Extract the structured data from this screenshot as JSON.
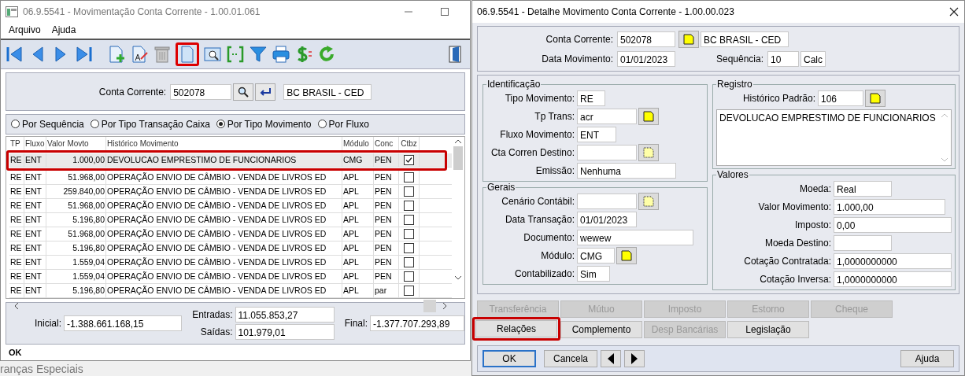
{
  "background": [
    {
      "text": "ranças Especiais"
    }
  ],
  "left_window": {
    "title": "06.9.5541 - Movimentação Conta Corrente - 1.00.01.061",
    "menu": [
      "Arquivo",
      "Ajuda"
    ],
    "conta_corrente": {
      "label": "Conta Corrente:",
      "value": "502078",
      "name": "BC BRASIL - CED"
    },
    "sort_options": [
      {
        "label": "Por Sequência",
        "selected": false
      },
      {
        "label": "Por Tipo Transação Caixa",
        "selected": false
      },
      {
        "label": "Por Tipo Movimento",
        "selected": true
      },
      {
        "label": "Por Fluxo",
        "selected": false
      }
    ],
    "table": {
      "columns": [
        "TP",
        "Fluxo",
        "Valor Movto",
        "Histórico Movimento",
        "Módulo",
        "Conc",
        "Ctbz"
      ],
      "rows": [
        {
          "tp": "RE",
          "fluxo": "ENT",
          "valor": "1.000,00",
          "historico": "DEVOLUCAO EMPRESTIMO DE FUNCIONARIOS",
          "modulo": "CMG",
          "conc": "PEN",
          "checked": true,
          "selected": true
        },
        {
          "tp": "RE",
          "fluxo": "ENT",
          "valor": "51.968,00",
          "historico": "OPERAÇÃO ENVIO DE CÂMBIO - VENDA DE LIVROS ED",
          "modulo": "APL",
          "conc": "PEN",
          "checked": false,
          "selected": false
        },
        {
          "tp": "RE",
          "fluxo": "ENT",
          "valor": "259.840,00",
          "historico": "OPERAÇÃO ENVIO DE CÂMBIO - VENDA DE LIVROS ED",
          "modulo": "APL",
          "conc": "PEN",
          "checked": false,
          "selected": false
        },
        {
          "tp": "RE",
          "fluxo": "ENT",
          "valor": "51.968,00",
          "historico": "OPERAÇÃO ENVIO DE CÂMBIO - VENDA DE LIVROS ED",
          "modulo": "APL",
          "conc": "PEN",
          "checked": false,
          "selected": false
        },
        {
          "tp": "RE",
          "fluxo": "ENT",
          "valor": "5.196,80",
          "historico": "OPERAÇÃO ENVIO DE CÂMBIO - VENDA DE LIVROS ED",
          "modulo": "APL",
          "conc": "PEN",
          "checked": false,
          "selected": false
        },
        {
          "tp": "RE",
          "fluxo": "ENT",
          "valor": "51.968,00",
          "historico": "OPERAÇÃO ENVIO DE CÂMBIO - VENDA DE LIVROS ED",
          "modulo": "APL",
          "conc": "PEN",
          "checked": false,
          "selected": false
        },
        {
          "tp": "RE",
          "fluxo": "ENT",
          "valor": "5.196,80",
          "historico": "OPERAÇÃO ENVIO DE CÂMBIO - VENDA DE LIVROS ED",
          "modulo": "APL",
          "conc": "PEN",
          "checked": false,
          "selected": false
        },
        {
          "tp": "RE",
          "fluxo": "ENT",
          "valor": "1.559,04",
          "historico": "OPERAÇÃO ENVIO DE CÂMBIO - VENDA DE LIVROS ED",
          "modulo": "APL",
          "conc": "PEN",
          "checked": false,
          "selected": false
        },
        {
          "tp": "RE",
          "fluxo": "ENT",
          "valor": "1.559,04",
          "historico": "OPERAÇÃO ENVIO DE CÂMBIO - VENDA DE LIVROS ED",
          "modulo": "APL",
          "conc": "PEN",
          "checked": false,
          "selected": false
        },
        {
          "tp": "RE",
          "fluxo": "ENT",
          "valor": "5.196,80",
          "historico": "OPERAÇÃO ENVIO DE CÂMBIO - VENDA DE LIVROS ED",
          "modulo": "APL",
          "conc": "par",
          "checked": false,
          "selected": false
        }
      ]
    },
    "totals": {
      "inicial": {
        "label": "Inicial:",
        "value": "-1.388.661.168,15"
      },
      "entradas": {
        "label": "Entradas:",
        "value": "11.055.853,27"
      },
      "saidas": {
        "label": "Saídas:",
        "value": "101.979,01"
      },
      "final": {
        "label": "Final:",
        "value": "-1.377.707.293,89"
      }
    },
    "status": "OK"
  },
  "right_window": {
    "title": "06.9.5541 - Detalhe Movimento Conta Corrente - 1.00.00.023",
    "header": {
      "conta_label": "Conta Corrente:",
      "conta_value": "502078",
      "conta_name": "BC BRASIL - CED",
      "data_label": "Data Movimento:",
      "data_value": "01/01/2023",
      "seq_label": "Sequência:",
      "seq_value": "10",
      "calc": "Calc"
    },
    "identificacao": {
      "title": "Identificação",
      "fields": [
        {
          "label": "Tipo Movimento:",
          "value": "RE",
          "kind": "plain"
        },
        {
          "label": "Tp Trans:",
          "value": "acr",
          "kind": "lookup"
        },
        {
          "label": "Fluxo Movimento:",
          "value": "ENT",
          "kind": "plain"
        },
        {
          "label": "Cta Corren Destino:",
          "kind": "lookupdim"
        },
        {
          "label": "Emissão:",
          "value": "Nenhuma",
          "kind": "plain"
        }
      ]
    },
    "gerais": {
      "title": "Gerais",
      "fields": [
        {
          "label": "Cenário Contábil:",
          "kind": "lookupdim"
        },
        {
          "label": "Data Transação:",
          "value": "01/01/2023",
          "kind": "plain"
        },
        {
          "label": "Documento:",
          "value": "wewew",
          "kind": "plain"
        },
        {
          "label": "Módulo:",
          "value": "CMG",
          "kind": "lookup"
        },
        {
          "label": "Contabilizado:",
          "value": "Sim",
          "kind": "plain"
        }
      ]
    },
    "registro": {
      "title": "Registro",
      "label": "Histórico Padrão:",
      "value": "106",
      "text": "DEVOLUCAO EMPRESTIMO DE FUNCIONARIOS"
    },
    "valores": {
      "title": "Valores",
      "fields": [
        {
          "label": "Moeda:",
          "value": "Real"
        },
        {
          "label": "Valor Movimento:",
          "value": "1.000,00"
        },
        {
          "label": "Imposto:",
          "value": "0,00"
        },
        {
          "label": "Moeda Destino:"
        },
        {
          "label": "Cotação Contratada:",
          "value": "1,0000000000"
        },
        {
          "label": "Cotação Inversa:",
          "value": "1,0000000000"
        }
      ]
    },
    "action_rows": [
      [
        {
          "label": "Transferência",
          "disabled": true
        },
        {
          "label": "Mútuo",
          "disabled": true
        },
        {
          "label": "Imposto",
          "disabled": true
        },
        {
          "label": "Estorno",
          "disabled": true
        },
        {
          "label": "Cheque",
          "disabled": true
        }
      ],
      [
        {
          "label": "Relações",
          "disabled": false
        },
        {
          "label": "Complemento",
          "disabled": false
        },
        {
          "label": "Desp Bancárias",
          "disabled": true
        },
        {
          "label": "Legislação",
          "disabled": false
        }
      ]
    ],
    "footer": {
      "ok": "OK",
      "cancel": "Cancela",
      "help": "Ajuda"
    }
  }
}
